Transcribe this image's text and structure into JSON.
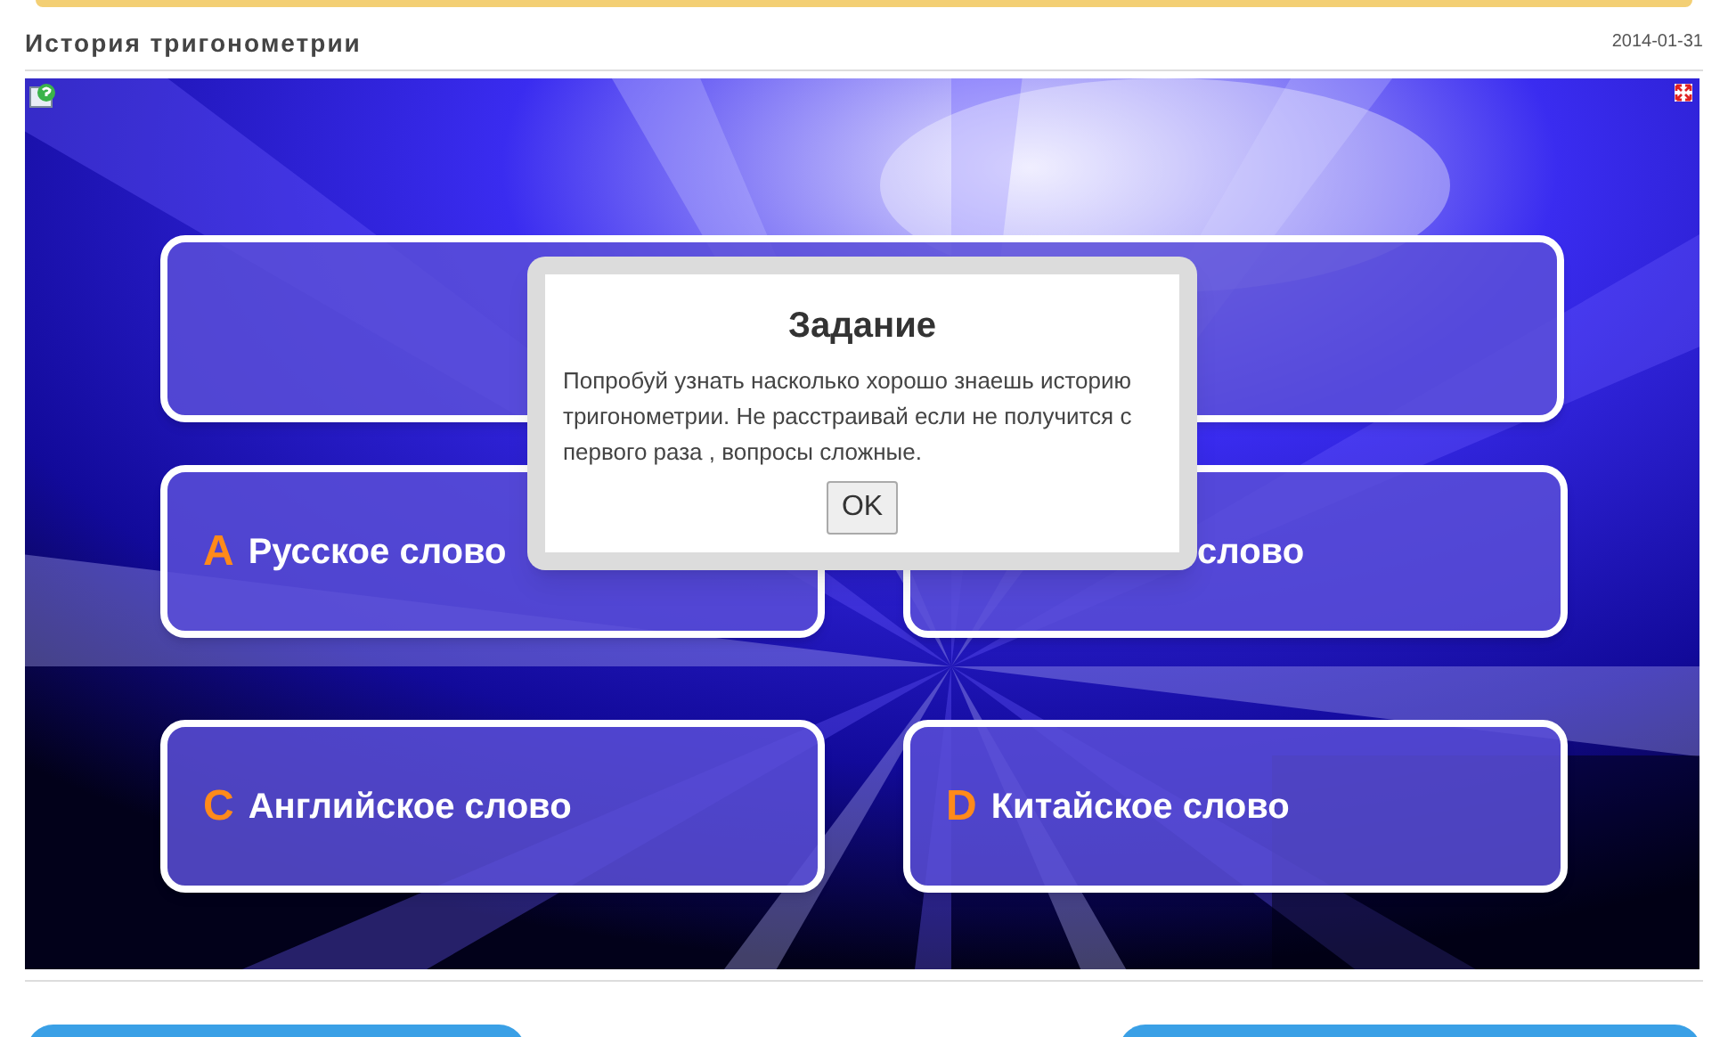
{
  "header": {
    "title": "История тригонометрии",
    "date": "2014-01-31"
  },
  "quiz": {
    "answers": [
      {
        "letter": "A",
        "text": "Русское слово"
      },
      {
        "text": "слово"
      },
      {
        "letter": "C",
        "text": "Английское слово"
      },
      {
        "letter": "D",
        "text": "Китайское слово"
      }
    ]
  },
  "dialog": {
    "title": "Задание",
    "message": "Попробуй узнать насколько хорошо знаешь историю тригонометрии. Не расстраивай если не получится с первого раза , вопросы сложные.",
    "button": "OK"
  }
}
